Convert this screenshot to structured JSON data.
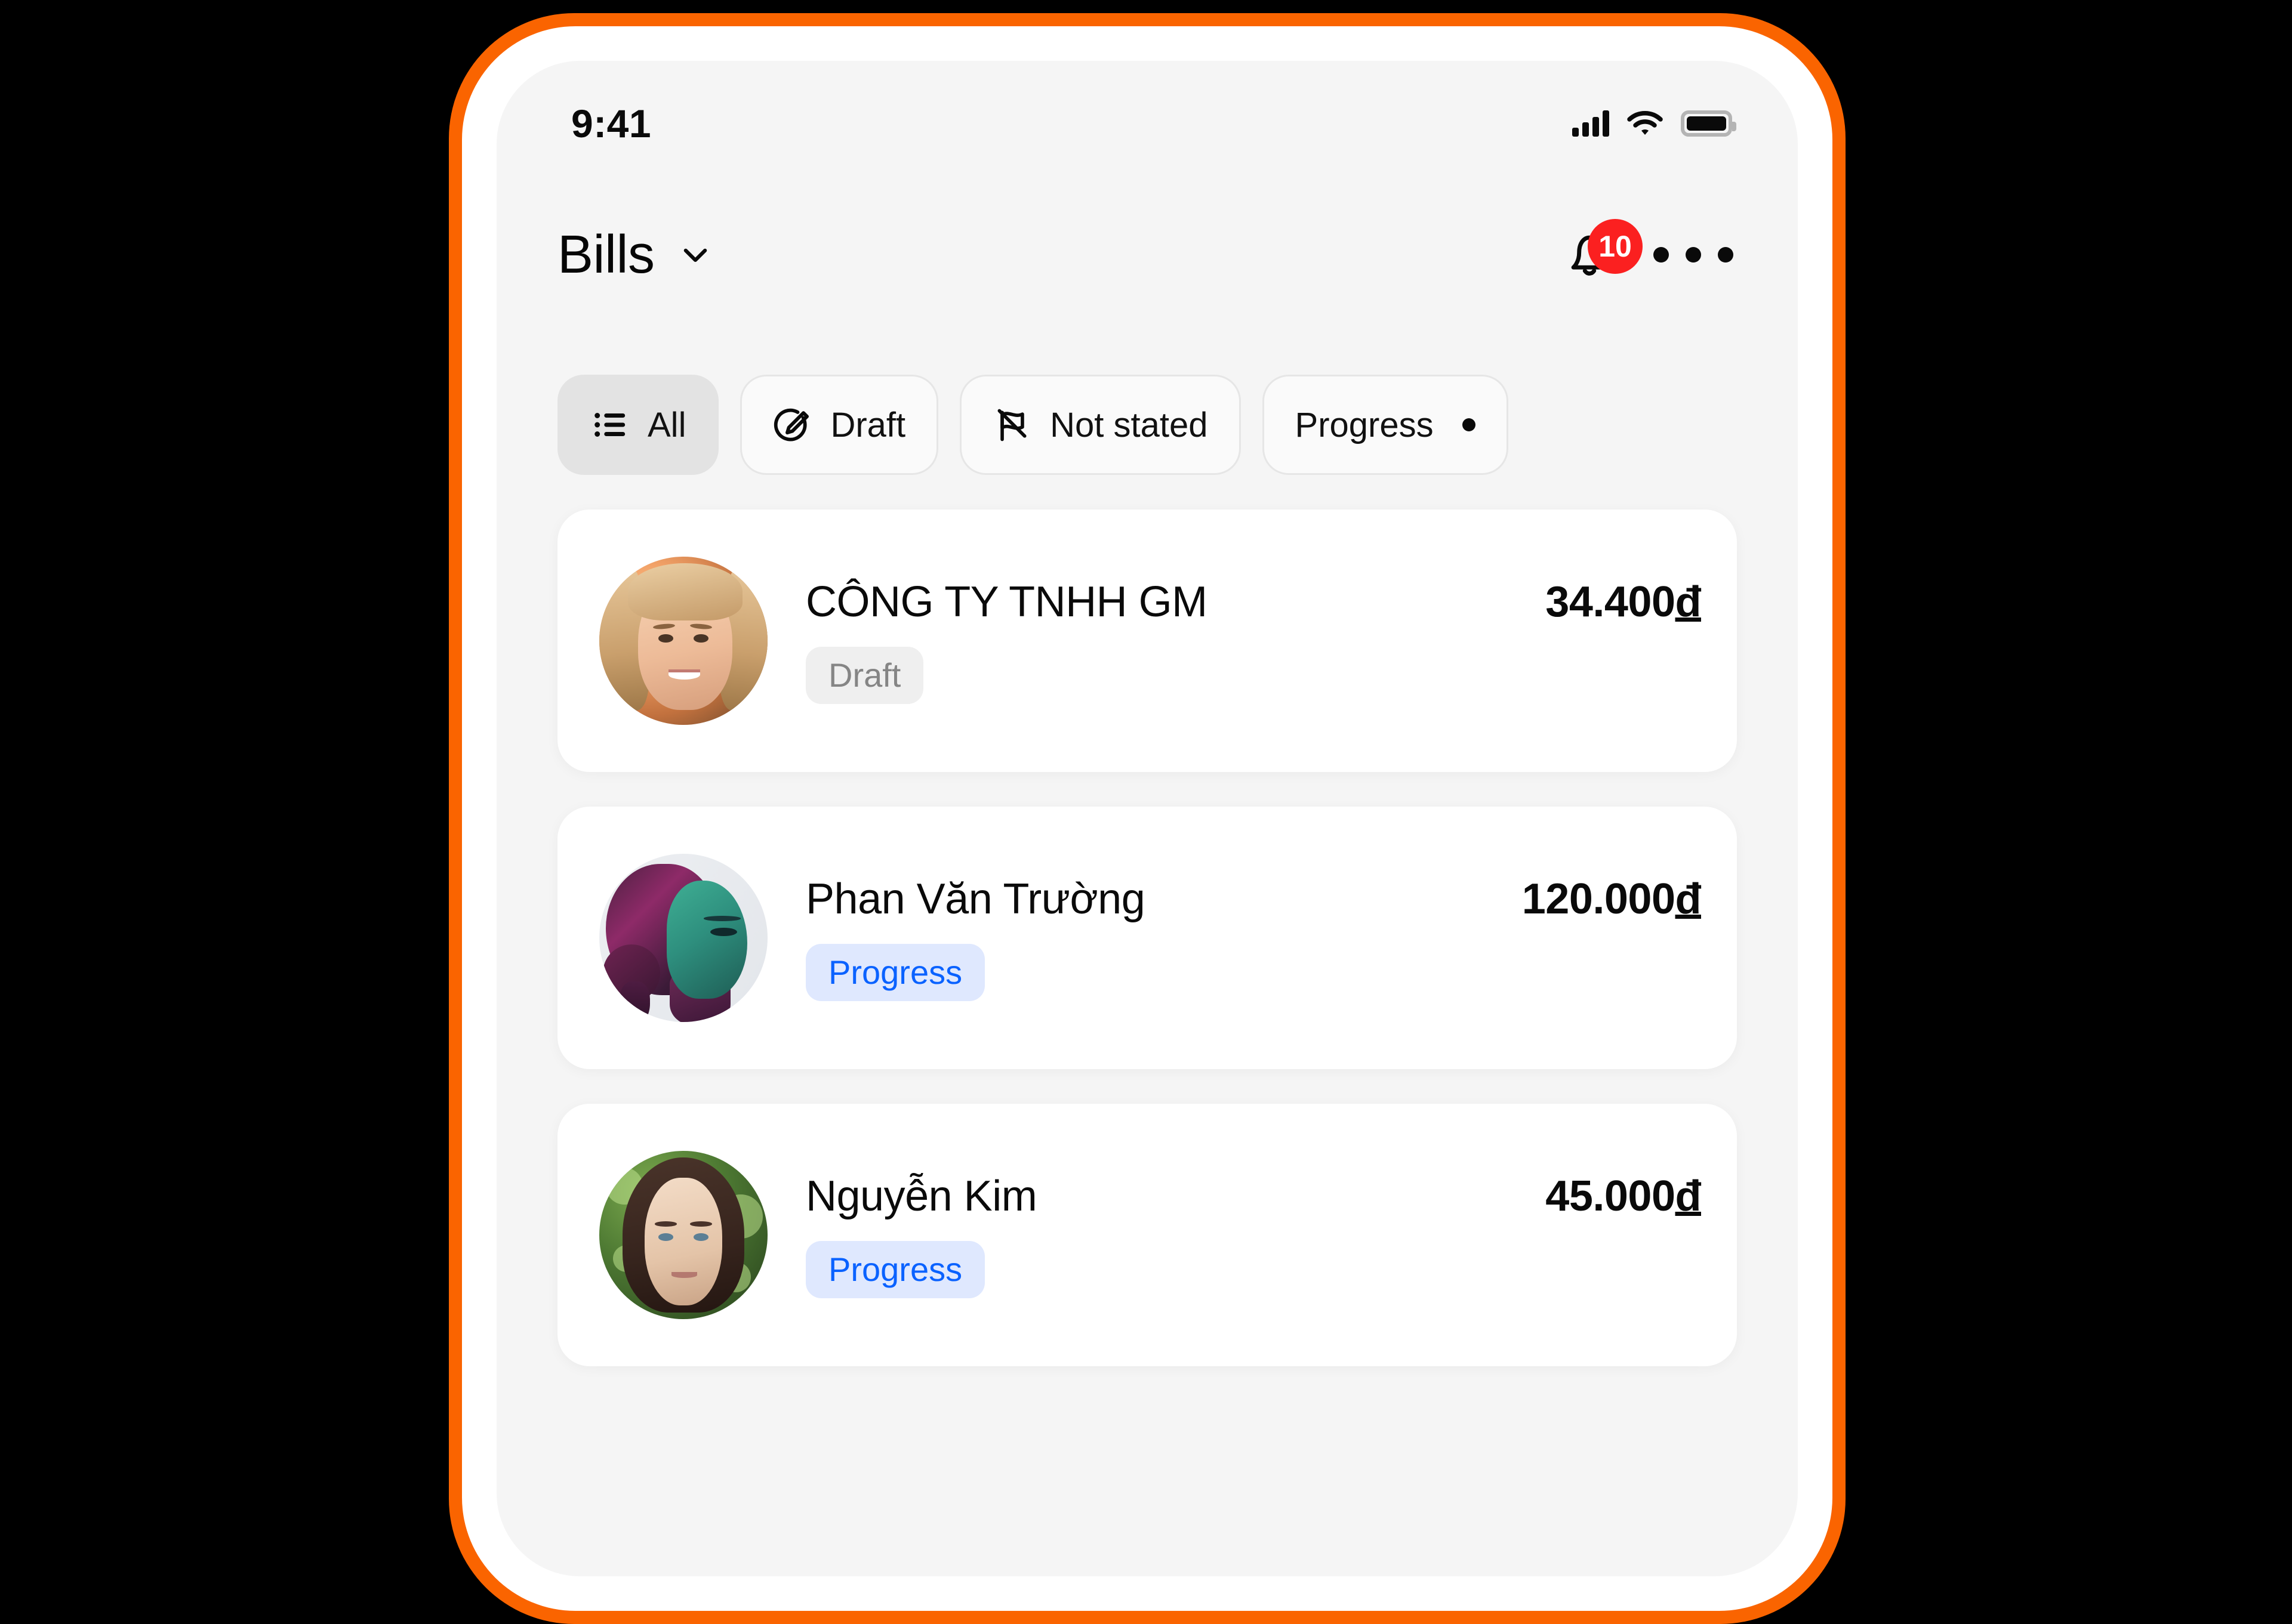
{
  "status_bar": {
    "time": "9:41",
    "signal_icon": "cellular-signal-icon",
    "wifi_icon": "wifi-icon",
    "battery_icon": "battery-full-icon"
  },
  "header": {
    "title": "Bills",
    "title_chevron_icon": "chevron-down-icon",
    "notifications": {
      "icon": "bell-icon",
      "badge_count": "10",
      "badge_color": "#FB2020"
    },
    "more_icon": "more-horizontal-icon"
  },
  "filters": {
    "chips": [
      {
        "label": "All",
        "icon": "list-bullet-icon",
        "selected": true
      },
      {
        "label": "Draft",
        "icon": "circle-pencil-icon",
        "selected": false
      },
      {
        "label": "Not stated",
        "icon": "flag-off-icon",
        "selected": false
      },
      {
        "label": "Progress",
        "icon": "",
        "selected": false
      }
    ]
  },
  "bills": [
    {
      "name": "CÔNG TY TNHH GM",
      "amount": "34.400",
      "currency": "đ",
      "status": "Draft",
      "status_style": "draft",
      "avatar": "avatar-blonde-sunset"
    },
    {
      "name": "Phan Văn Trường",
      "amount": "120.000",
      "currency": "đ",
      "status": "Progress",
      "status_style": "progress",
      "avatar": "avatar-duotone-profile"
    },
    {
      "name": "Nguyễn Kim",
      "amount": "45.000",
      "currency": "đ",
      "status": "Progress",
      "status_style": "progress",
      "avatar": "avatar-green-foliage"
    }
  ],
  "theme": {
    "device_frame": "#FA6400",
    "screen_bg": "#F5F5F5",
    "card_bg": "#FFFFFF",
    "badge_draft_bg": "#EFEFEF",
    "badge_draft_text": "#858585",
    "badge_progress_bg": "#DFE8FE",
    "badge_progress_text": "#0A62FF"
  }
}
